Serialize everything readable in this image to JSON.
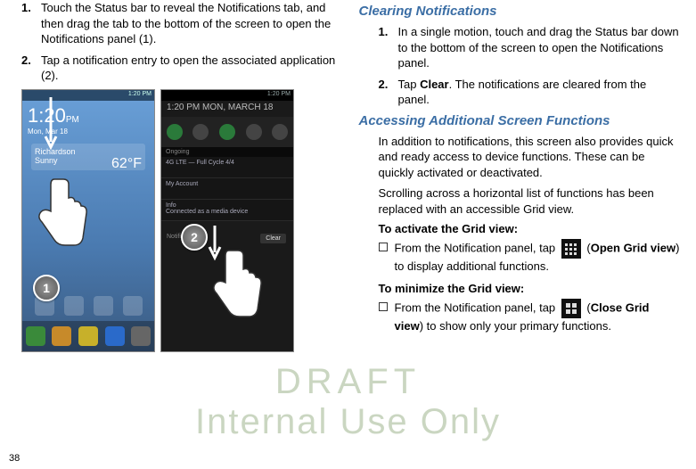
{
  "left": {
    "step1_num": "1.",
    "step1_text": "Touch the Status bar to reveal the Notifications tab, and then drag the tab to the bottom of the screen to open the Notifications panel (1).",
    "step2_num": "2.",
    "step2_text": "Tap a notification entry to open the associated application (2).",
    "phone1": {
      "status": "1:20 PM",
      "clock": "1:20",
      "ampm": "PM",
      "day": "Mon, Mar 18",
      "weather_city": "Richardson",
      "weather_cond": "Sunny",
      "weather_temp": "62°F",
      "badge": "1"
    },
    "phone2": {
      "status": "1:20 PM",
      "time_line": "1:20 PM  MON, MARCH 18",
      "ongoing": "Ongoing",
      "row1": "4G LTE — Full Cycle 4/4",
      "row2": "My Account",
      "row3_title": "Info",
      "row3_sub": "Connected as a media device",
      "notifs_label": "Notifications",
      "clear": "Clear",
      "badge": "2"
    }
  },
  "right": {
    "heading1": "Clearing Notifications",
    "c1_num": "1.",
    "c1_text": "In a single motion, touch and drag the Status bar down to the bottom of the screen to open the Notifications panel.",
    "c2_num": "2.",
    "c2_pre": "Tap ",
    "c2_bold": "Clear",
    "c2_post": ". The notifications are cleared from the panel.",
    "heading2": "Accessing Additional Screen Functions",
    "p1": "In addition to notifications, this screen also provides quick and ready access to device functions. These can be quickly activated or deactivated.",
    "p2": "Scrolling across a horizontal list of functions has been replaced with an accessible Grid view.",
    "activate_label": "To activate the Grid view:",
    "b1_pre": "From the Notification panel, tap ",
    "b1_paren_open": "(",
    "b1_bold": "Open Grid view",
    "b1_paren_close": ")",
    "b1_post": " to display additional functions.",
    "minimize_label": "To minimize the Grid view:",
    "b2_pre": "From the Notification panel, tap ",
    "b2_bold": "Close Grid view",
    "b2_post": " to show only your primary functions."
  },
  "watermark": {
    "l1": "DRAFT",
    "l2": "Internal Use Only"
  },
  "page_number": "38"
}
